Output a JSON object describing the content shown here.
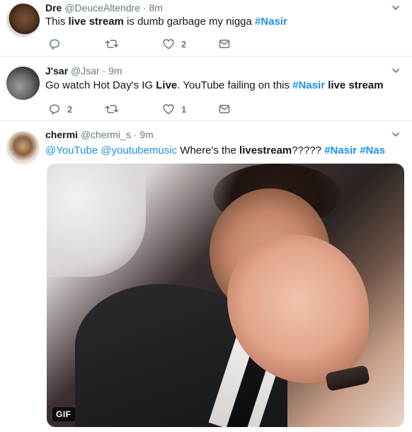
{
  "colors": {
    "link": "#1b95e0",
    "muted": "#657786",
    "text": "#14171a",
    "divider": "#e6ecf0"
  },
  "tweets": [
    {
      "name": "Dre",
      "handle": "@DeuceAltendre",
      "time": "· 8m",
      "text_parts": [
        "This ",
        "live stream",
        " is dumb garbage my nigga ",
        "#Nasir"
      ],
      "reply_count": "",
      "retweet_count": "",
      "like_count": "2",
      "icons": [
        "reply-icon",
        "retweet-icon",
        "like-icon",
        "message-icon",
        "caret-down-icon"
      ]
    },
    {
      "name": "J'sar",
      "handle": "@Jsar",
      "time": "· 9m",
      "text_parts": [
        "Go watch Hot Day's IG ",
        "Live",
        ". YouTube failing on this ",
        "#Nasir",
        " ",
        "live stream"
      ],
      "reply_count": "2",
      "retweet_count": "",
      "like_count": "1",
      "icons": [
        "reply-icon",
        "retweet-icon",
        "like-icon",
        "message-icon",
        "caret-down-icon"
      ]
    },
    {
      "name": "chermi",
      "handle": "@chermi_s",
      "time": "· 9m",
      "text_parts": [
        "@YouTube",
        " ",
        "@youtubemusic",
        " Where's the ",
        "livestream",
        "????? ",
        "#Nasir",
        " ",
        "#Nas"
      ],
      "media_badge": "GIF",
      "icons": [
        "caret-down-icon"
      ]
    }
  ]
}
